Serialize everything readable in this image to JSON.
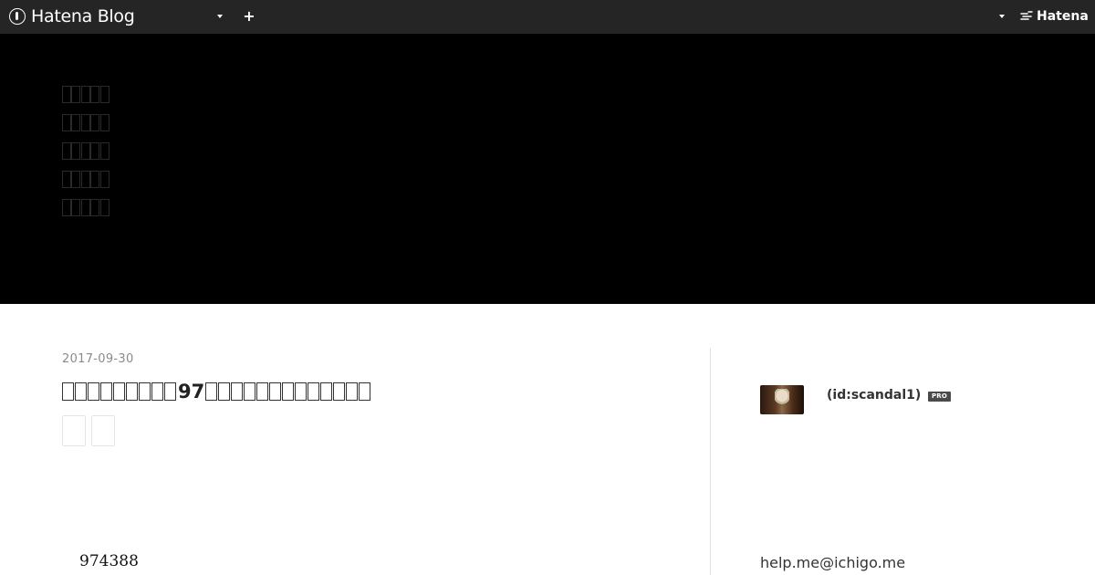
{
  "globalbar": {
    "logo_text": "Hatena Blog",
    "hatena_text": "Hatena"
  },
  "header": {
    "title_lines": [
      "□□□□□",
      "□□□□□",
      "□□□□□",
      "□□□□□",
      "□□□□□"
    ]
  },
  "entry": {
    "date": "2017-09-30",
    "title_prefix_glyphs": 9,
    "title_number": "97",
    "title_suffix_glyphs": 13,
    "body_number": "974388"
  },
  "sidebar": {
    "user_id": "(id:scandal1)",
    "pro_badge": "PRO",
    "email": "help.me@ichigo.me"
  }
}
